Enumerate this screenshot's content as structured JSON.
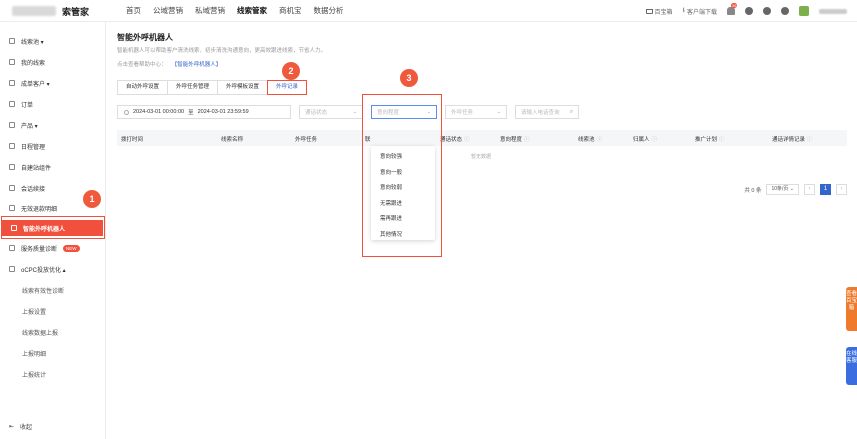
{
  "header": {
    "brand": "索管家",
    "nav": [
      "首页",
      "公域营销",
      "私域营销",
      "线索管家",
      "商机宝",
      "数据分析"
    ],
    "active_nav": "线索管家",
    "right": {
      "baidu": "百宝箱",
      "download": "客户端下载",
      "notice_count": "36"
    }
  },
  "sidebar": {
    "items": [
      {
        "label": "线索池 ▾"
      },
      {
        "label": "我的线索"
      },
      {
        "label": "成单客户 ▾"
      },
      {
        "label": "订单"
      },
      {
        "label": "产品 ▾"
      },
      {
        "label": "日程管理"
      },
      {
        "label": "自建站组件"
      },
      {
        "label": "会话续接"
      },
      {
        "label": "无效退款明细"
      },
      {
        "label": "智能外呼机器人"
      },
      {
        "label": "服务质量诊断",
        "badge": "NEW"
      },
      {
        "label": "oCPC投放优化 ▴"
      },
      {
        "label": "线索有效性诊断"
      },
      {
        "label": "上报设置"
      },
      {
        "label": "线索数据上报"
      },
      {
        "label": "上报明细"
      },
      {
        "label": "上报统计"
      }
    ],
    "collapse": "收起"
  },
  "steps": [
    "1",
    "2",
    "3"
  ],
  "main": {
    "title": "智能外呼机器人",
    "desc": "智能机器人可以帮助客户清洗线索、初步清洗沟通意向，更高效跟进线索，节省人力。",
    "help_prefix": "点击查看帮助中心：",
    "help_link": "【智能外呼机器人】",
    "tabs": [
      "自动外呼设置",
      "外呼任务管理",
      "外呼模板设置",
      "外呼记录"
    ],
    "active_tab": "外呼记录",
    "filters": {
      "date_start": "2024-03-01 00:00:00",
      "date_sep": "至",
      "date_end": "2024-03-01 23:59:59",
      "status_placeholder": "通话状态",
      "intent_placeholder": "意向程度",
      "task_placeholder": "外呼任务",
      "phone_placeholder": "请输入电话查询"
    },
    "table": {
      "columns": [
        "拨打时间",
        "线索名称",
        "外呼任务",
        "联",
        "通话状态",
        "意向程度",
        "线索池",
        "归属人",
        "推广计划",
        "通话详情记录"
      ],
      "empty": "暂无数据"
    },
    "pager": {
      "total": "共 0 条",
      "page_size": "10条/页",
      "current": "1"
    },
    "intent_options": [
      "意向较强",
      "意向一般",
      "意向较弱",
      "无需跟进",
      "需再跟进",
      "其他情况"
    ]
  },
  "float": {
    "baidu_box": "查看百宝箱",
    "online_service": "在线客服"
  },
  "colors": {
    "accent": "#f0503c",
    "link": "#3366cc"
  }
}
